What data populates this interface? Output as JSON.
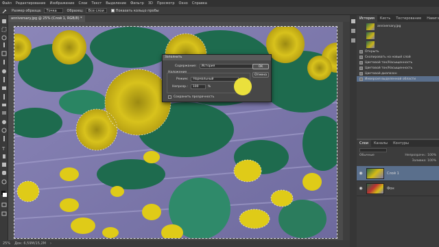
{
  "menu": [
    "Файл",
    "Редактирование",
    "Изображение",
    "Слои",
    "Текст",
    "Выделение",
    "Фильтр",
    "3D",
    "Просмотр",
    "Окно",
    "Справка"
  ],
  "options": {
    "sample_size_label": "Размер образца:",
    "sample_size_value": "Точка",
    "sample_label": "Образец:",
    "sample_value": "Все слои",
    "show_ring_label": "Показать кольцо пробы"
  },
  "document": {
    "tab_title": "anniversary.jpg @ 25% (Слой 1, RGB/8) *"
  },
  "status": {
    "zoom": "25%",
    "info": "Док: 6,59M/15,2M",
    "arrow": "›"
  },
  "history_panel": {
    "tabs": [
      "История",
      "Кисть",
      "Тестирование",
      "Навигатор"
    ],
    "snapshot_name": "anniversary.jpg",
    "items": [
      "Открыть",
      "Скопировать на новый слой",
      "Цветовой тон/Насыщенность",
      "Цветовой тон/Насыщенность",
      "Цветовой диапазон",
      "Инверсия выделенной области"
    ],
    "active_index": 5
  },
  "layers_panel": {
    "tabs": [
      "Слои",
      "Каналы",
      "Контуры"
    ],
    "blend_mode": "Обычные",
    "opacity_label": "Непрозрачн.:",
    "opacity_value": "100%",
    "fill_label": "Заливка:",
    "fill_value": "100%",
    "layers": [
      {
        "name": "Слой 1",
        "active": true
      },
      {
        "name": "Фон",
        "active": false
      }
    ]
  },
  "fill_dialog": {
    "title": "Заполнить",
    "contents_label": "Содержание:",
    "contents_value": "История",
    "blending_group": "Наложение",
    "mode_label": "Режим:",
    "mode_value": "Нормальный",
    "opacity_label": "Непрозр.:",
    "opacity_value": "100",
    "opacity_unit": "%",
    "preserve_label": "Сохранить прозрачность",
    "ok": "OK",
    "cancel": "Отмена"
  },
  "colors": {
    "accent_selection": "#5a6f8c",
    "cursor_highlight": "#f8ee3c"
  }
}
